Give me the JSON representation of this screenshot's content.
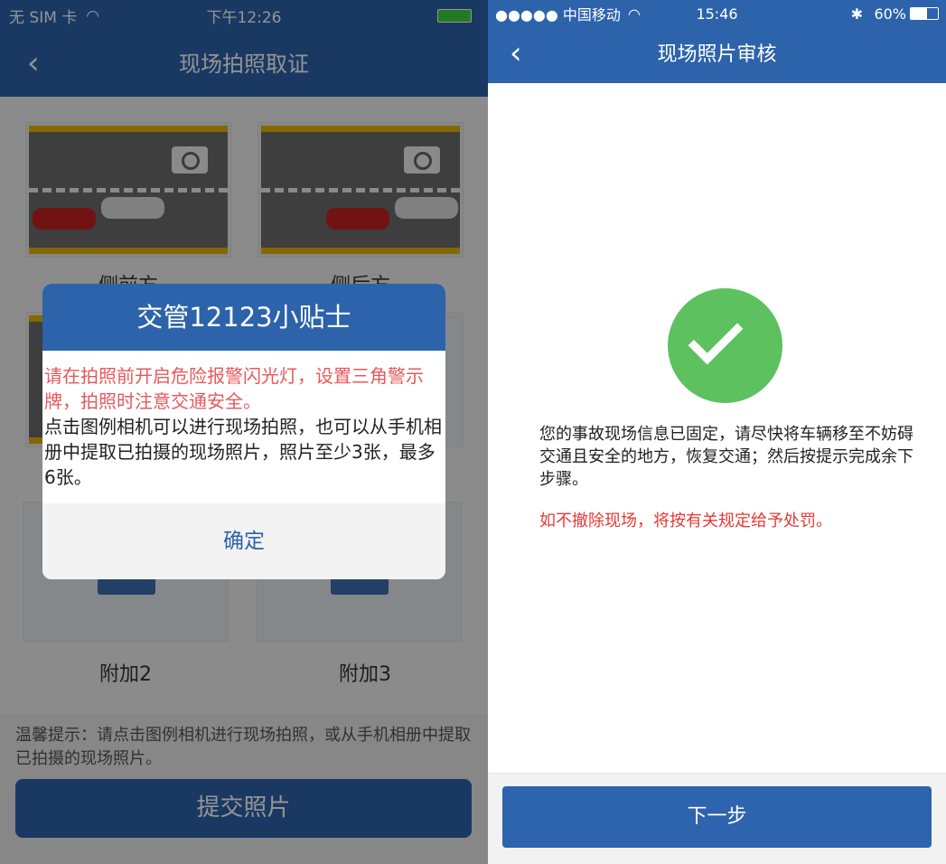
{
  "left": {
    "status": {
      "carrier": "无 SIM 卡",
      "time": "下午12:26"
    },
    "header": {
      "title": "现场拍照取证",
      "back_icon": "chevron-left-icon"
    },
    "photos": [
      {
        "label": "侧前方"
      },
      {
        "label": "侧后方"
      },
      {
        "label": ""
      },
      {
        "label": ""
      },
      {
        "label": "附加2"
      },
      {
        "label": "附加3"
      }
    ],
    "tip": "温馨提示：请点击图例相机进行现场拍照，或从手机相册中提取已拍摄的现场照片。",
    "submit_label": "提交照片",
    "modal": {
      "title": "交管12123小贴士",
      "warning": "请在拍照前开启危险报警闪光灯，设置三角警示牌，拍照时注意交通安全。",
      "body": "点击图例相机可以进行现场拍照，也可以从手机相册中提取已拍摄的现场照片，照片至少3张，最多6张。",
      "confirm_label": "确定"
    }
  },
  "right": {
    "status": {
      "carrier": "●●●●● 中国移动",
      "time": "15:46",
      "battery": "60%"
    },
    "header": {
      "title": "现场照片审核"
    },
    "message": "您的事故现场信息已固定，请尽快将车辆移至不妨碍交通且安全的地方，恢复交通；然后按提示完成余下步骤。",
    "warning": "如不撤除现场，将按有关规定给予处罚。",
    "next_label": "下一步"
  },
  "colors": {
    "primary": "#2c63ab",
    "success": "#5cc15e",
    "warning": "#e53935"
  }
}
